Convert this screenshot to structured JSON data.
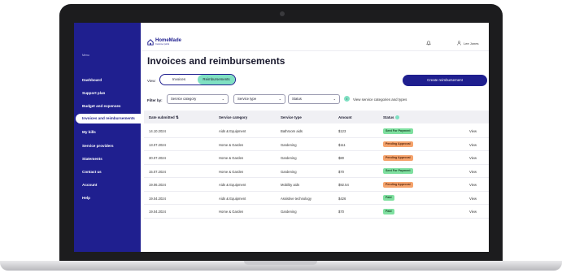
{
  "sidebar": {
    "menu_label": "Menu",
    "items": [
      {
        "label": "Dashboard"
      },
      {
        "label": "Support plan"
      },
      {
        "label": "Budget and expenses"
      },
      {
        "label": "Invoices and reimbursements"
      },
      {
        "label": "My bills"
      },
      {
        "label": "Service providers"
      },
      {
        "label": "Statements"
      },
      {
        "label": "Contact us"
      },
      {
        "label": "Account"
      },
      {
        "label": "Help"
      }
    ],
    "active_index": 3,
    "bg_color": "#1f1f8f"
  },
  "header": {
    "logo_text": "HomeMade",
    "logo_subtext": "Customer portal",
    "user_name": "Lee Jones",
    "bell_icon": "bell-icon",
    "user_icon": "user-icon"
  },
  "main": {
    "title": "Invoices and reimbursements",
    "view_label": "View:",
    "toggle": {
      "options": [
        "Invoices",
        "Reimbursements"
      ],
      "selected": "Reimbursements"
    },
    "create_button": "Create reimbursement",
    "filter_label": "Filter by:",
    "filters": [
      {
        "label": "Service category"
      },
      {
        "label": "Service type"
      },
      {
        "label": "Status"
      }
    ],
    "info_link": "View service categories and types",
    "table": {
      "headers": [
        "Date submitted",
        "Service category",
        "Service type",
        "Amount",
        "Status"
      ],
      "rows": [
        {
          "date": "14.10.2024",
          "category": "Aids & Equipment",
          "type": "Bathroom aids",
          "amount": "$123",
          "status": "Sent For Payment",
          "status_kind": "sent",
          "action": "View"
        },
        {
          "date": "13.07.2024",
          "category": "Home & Garden",
          "type": "Gardening",
          "amount": "$111",
          "status": "Pending Approval",
          "status_kind": "pending",
          "action": "View"
        },
        {
          "date": "30.07.2024",
          "category": "Home & Garden",
          "type": "Gardening",
          "amount": "$80",
          "status": "Pending Approval",
          "status_kind": "pending",
          "action": "View"
        },
        {
          "date": "15.07.2024",
          "category": "Home & Garden",
          "type": "Gardening",
          "amount": "$70",
          "status": "Sent For Payment",
          "status_kind": "sent",
          "action": "View"
        },
        {
          "date": "19.06.2024",
          "category": "Aids & Equipment",
          "type": "Mobility aids",
          "amount": "$92.54",
          "status": "Pending Approval",
          "status_kind": "pending",
          "action": "View"
        },
        {
          "date": "19.04.2024",
          "category": "Aids & Equipment",
          "type": "Assistive technology",
          "amount": "$426",
          "status": "Paid",
          "status_kind": "paid",
          "action": "View"
        },
        {
          "date": "19.04.2024",
          "category": "Home & Garden",
          "type": "Gardening",
          "amount": "$70",
          "status": "Paid",
          "status_kind": "paid",
          "action": "View"
        }
      ]
    }
  },
  "colors": {
    "brand": "#1f1f8f",
    "accent": "#7fe0c2",
    "pending": "#f5a36c",
    "sent": "#7fe0a0"
  }
}
